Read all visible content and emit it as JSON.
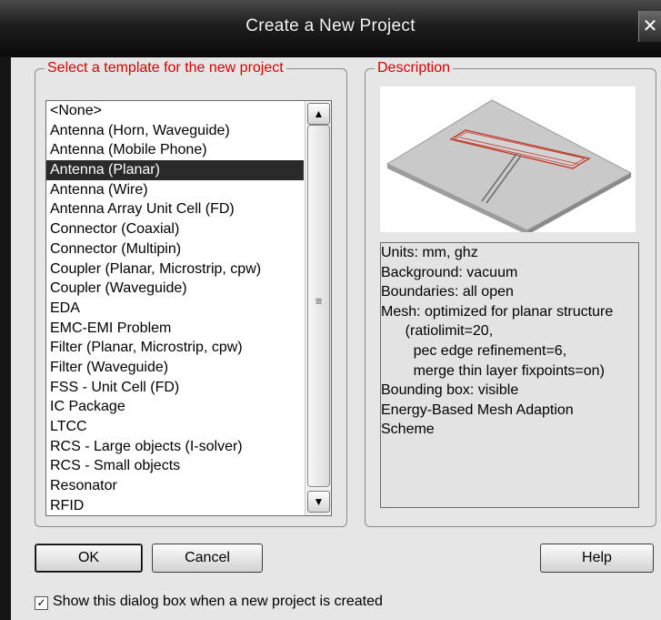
{
  "window": {
    "title": "Create a New Project",
    "close_glyph": "✕"
  },
  "template_group": {
    "legend": "Select a template for the new project",
    "items": [
      "<None>",
      "Antenna (Horn, Waveguide)",
      "Antenna (Mobile Phone)",
      "Antenna (Planar)",
      "Antenna (Wire)",
      "Antenna Array Unit Cell (FD)",
      "Connector (Coaxial)",
      "Connector (Multipin)",
      "Coupler (Planar, Microstrip, cpw)",
      "Coupler (Waveguide)",
      "EDA",
      "EMC-EMI Problem",
      "Filter (Planar, Microstrip, cpw)",
      "Filter (Waveguide)",
      "FSS - Unit Cell (FD)",
      "IC Package",
      "LTCC",
      "RCS - Large objects (I-solver)",
      "RCS - Small objects",
      "Resonator",
      "RFID"
    ],
    "selected_index": 3,
    "scroll_up_glyph": "▲",
    "scroll_down_glyph": "▼",
    "scroll_grip_glyph": "≡"
  },
  "description_group": {
    "legend": "Description",
    "lines": [
      "Units: mm, ghz",
      "Background: vacuum",
      "Boundaries: all open",
      "Mesh: optimized for planar structure",
      "      (ratiolimit=20,",
      "        pec edge refinement=6,",
      "        merge thin layer fixpoints=on)",
      "Bounding box: visible",
      "Energy-Based Mesh Adaption",
      "Scheme"
    ]
  },
  "buttons": {
    "ok": "OK",
    "cancel": "Cancel",
    "help": "Help"
  },
  "show_dialog_checkbox": {
    "label": "Show this dialog box when a new project is created",
    "checked": true,
    "check_glyph": "✓"
  },
  "colors": {
    "legend_red": "#d40000",
    "selection": "#2a2a2a",
    "antenna_pattern": "#c0392b"
  }
}
